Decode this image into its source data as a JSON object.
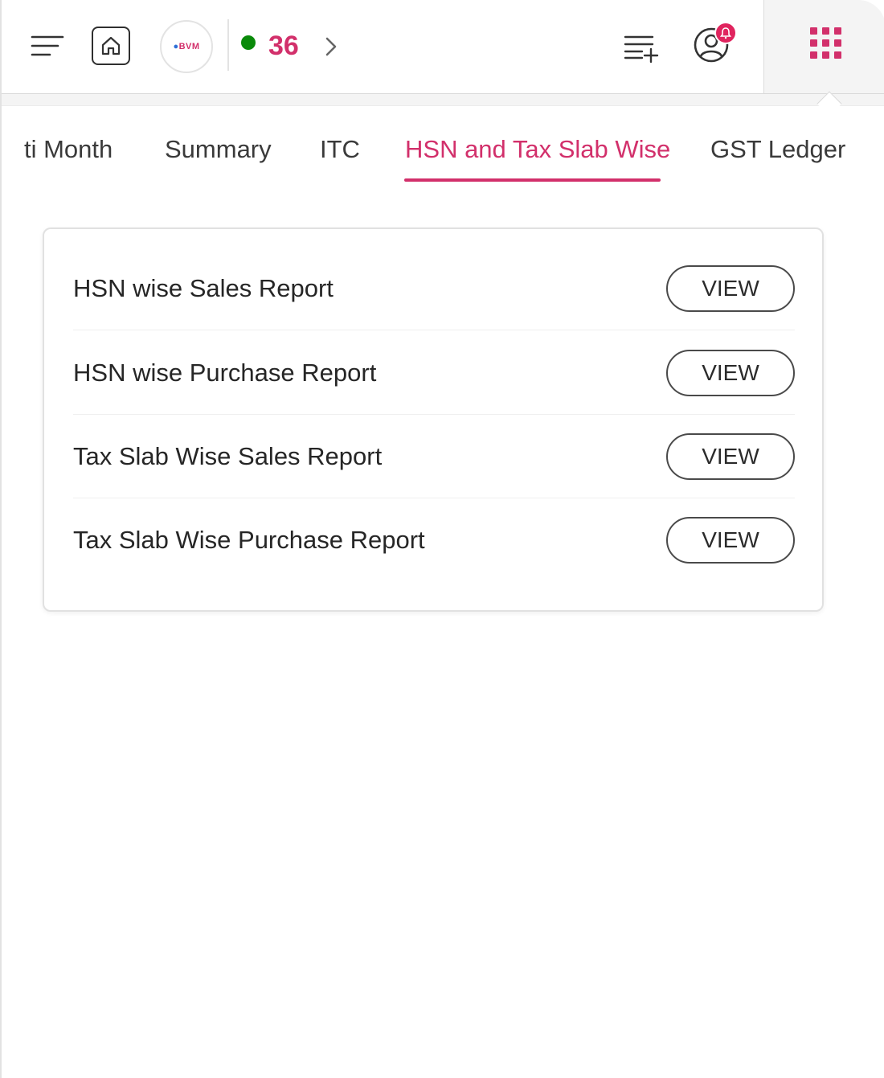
{
  "header": {
    "logo_text_a": "BVM",
    "status_count": "36",
    "icons": {
      "menu": "menu-icon",
      "home": "home-icon",
      "chevron": "chevron-right-icon",
      "add_list": "playlist-add-icon",
      "profile": "profile-icon",
      "notification": "bell-icon",
      "apps": "apps-grid-icon"
    },
    "colors": {
      "accent": "#d2306b",
      "status_online": "#0a8a0a",
      "badge": "#e0245e"
    }
  },
  "tabs": [
    {
      "label": "ti Month",
      "active": false
    },
    {
      "label": "Summary",
      "active": false
    },
    {
      "label": "ITC",
      "active": false
    },
    {
      "label": "HSN and Tax Slab Wise",
      "active": true
    },
    {
      "label": "GST Ledger",
      "active": false
    }
  ],
  "reports": [
    {
      "label": "HSN wise Sales Report",
      "button": "VIEW"
    },
    {
      "label": "HSN wise Purchase Report",
      "button": "VIEW"
    },
    {
      "label": "Tax Slab Wise Sales Report",
      "button": "VIEW"
    },
    {
      "label": "Tax Slab Wise Purchase Report",
      "button": "VIEW"
    }
  ]
}
